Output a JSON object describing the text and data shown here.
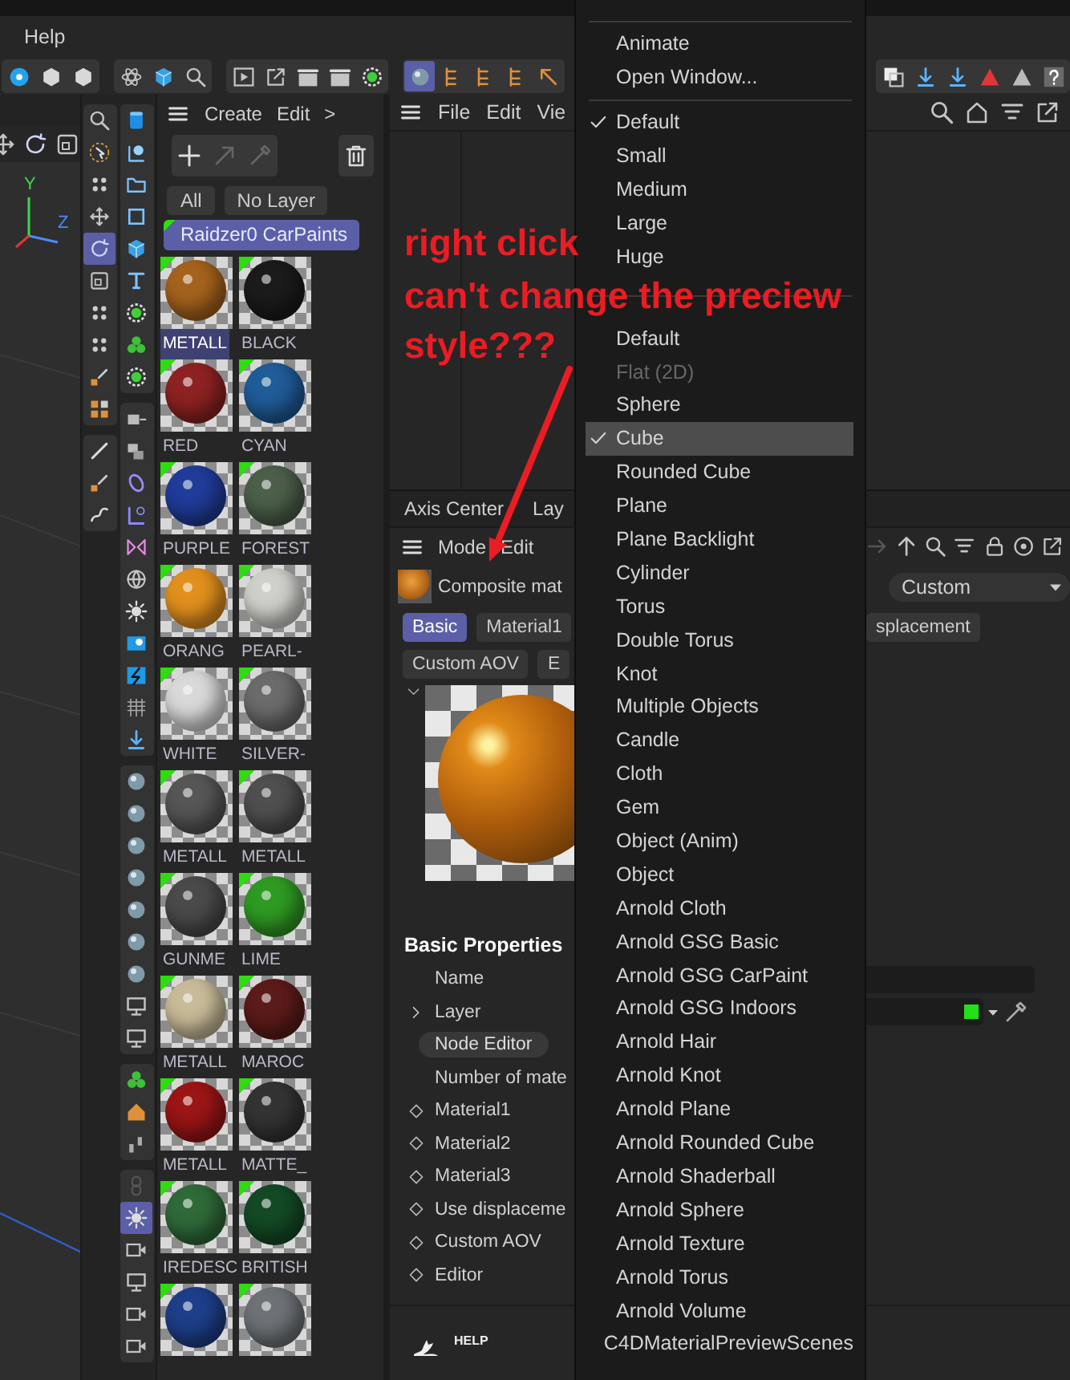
{
  "menu_bar": {
    "items": [
      "Help"
    ]
  },
  "toolbar": {
    "groups": [
      {
        "tools": [
          {
            "kind": "badge",
            "selected": false
          },
          {
            "kind": "hex",
            "selected": false
          },
          {
            "kind": "hex",
            "selected": false
          }
        ]
      },
      {
        "tools": [
          {
            "kind": "atom",
            "selected": false
          },
          {
            "kind": "cube",
            "selected": false
          },
          {
            "kind": "search",
            "selected": false
          }
        ]
      },
      {
        "tools": [
          {
            "kind": "play",
            "selected": false
          },
          {
            "kind": "external",
            "selected": false
          },
          {
            "kind": "film",
            "selected": false
          },
          {
            "kind": "film",
            "selected": false
          },
          {
            "kind": "gear",
            "selected": false
          }
        ]
      },
      {
        "tools": [
          {
            "kind": "sphere",
            "selected": true
          },
          {
            "kind": "tree",
            "selected": false
          },
          {
            "kind": "tree",
            "selected": false
          },
          {
            "kind": "tree",
            "selected": false
          },
          {
            "kind": "arrow",
            "selected": false
          }
        ]
      },
      {
        "tools": [
          {
            "kind": "stack",
            "selected": false
          },
          {
            "kind": "download",
            "selected": false
          },
          {
            "kind": "download",
            "selected": false
          },
          {
            "kind": "triangle",
            "selected": false
          },
          {
            "kind": "warn",
            "selected": false
          },
          {
            "kind": "help",
            "selected": false
          }
        ]
      }
    ]
  },
  "viewport": {
    "gizmo": {
      "y_label": "Y",
      "z_label": "Z"
    }
  },
  "tool_column_1": {
    "groups": [
      {
        "tools": [
          {
            "kind": "search",
            "selected": false
          },
          {
            "kind": "cursor",
            "selected": false
          },
          {
            "kind": "dots",
            "selected": false
          },
          {
            "kind": "move",
            "selected": false
          },
          {
            "kind": "rotate",
            "selected": true
          },
          {
            "kind": "scale",
            "selected": false
          },
          {
            "kind": "dots",
            "selected": false
          },
          {
            "kind": "dots",
            "selected": false
          },
          {
            "kind": "pen",
            "selected": false
          },
          {
            "kind": "cubes",
            "selected": false
          }
        ]
      },
      {
        "tools": [
          {
            "kind": "brush",
            "selected": false
          },
          {
            "kind": "pen",
            "selected": false
          },
          {
            "kind": "spline",
            "selected": false
          }
        ]
      }
    ]
  },
  "tool_column_2": {
    "groups": [
      {
        "tools": [
          {
            "kind": "cylinder",
            "selected": false
          },
          {
            "kind": "frame",
            "selected": false
          },
          {
            "kind": "folder",
            "selected": false
          },
          {
            "kind": "square",
            "selected": false
          },
          {
            "kind": "cube",
            "selected": false
          },
          {
            "kind": "text",
            "selected": false
          },
          {
            "kind": "gear",
            "selected": false
          },
          {
            "kind": "clover",
            "selected": false
          },
          {
            "kind": "gear",
            "selected": false
          }
        ]
      },
      {
        "tools": [
          {
            "kind": "crate",
            "selected": false
          },
          {
            "kind": "crates",
            "selected": false
          },
          {
            "kind": "ring",
            "selected": false
          },
          {
            "kind": "bracket",
            "selected": false
          },
          {
            "kind": "bow",
            "selected": false
          },
          {
            "kind": "globe",
            "selected": false
          },
          {
            "kind": "sun",
            "selected": false
          },
          {
            "kind": "box",
            "selected": false
          },
          {
            "kind": "bolt",
            "selected": false
          },
          {
            "kind": "grid",
            "selected": false
          },
          {
            "kind": "download",
            "selected": false
          }
        ]
      },
      {
        "tools": [
          {
            "kind": "sphere",
            "selected": false
          },
          {
            "kind": "sphere",
            "selected": false
          },
          {
            "kind": "sphere",
            "selected": false
          },
          {
            "kind": "sphere",
            "selected": false
          },
          {
            "kind": "sphere",
            "selected": false
          },
          {
            "kind": "sphere",
            "selected": false
          },
          {
            "kind": "sphere",
            "selected": false
          },
          {
            "kind": "monitor",
            "selected": false
          },
          {
            "kind": "monitor",
            "selected": false
          }
        ]
      },
      {
        "tools": [
          {
            "kind": "clover",
            "selected": false
          },
          {
            "kind": "house",
            "selected": false
          },
          {
            "kind": "bars",
            "selected": false
          }
        ]
      },
      {
        "tools": [
          {
            "kind": "link",
            "selected": false
          },
          {
            "kind": "sun",
            "selected": true
          },
          {
            "kind": "camera",
            "selected": false
          },
          {
            "kind": "monitor",
            "selected": false
          },
          {
            "kind": "camera",
            "selected": false
          },
          {
            "kind": "camera",
            "selected": false
          }
        ]
      }
    ]
  },
  "material_manager": {
    "menu": [
      "Create",
      "Edit",
      ">"
    ],
    "actions": [
      {
        "kind": "add",
        "disabled": false
      },
      {
        "kind": "arrow",
        "disabled": true
      },
      {
        "kind": "eyedropper",
        "disabled": true
      },
      {
        "kind": "delete",
        "disabled": false
      }
    ],
    "filters": [
      {
        "label": "All",
        "selected": false
      },
      {
        "label": "No Layer",
        "selected": false
      }
    ],
    "layer": "Raidzer0 CarPaints",
    "materials": [
      {
        "name": "METALL",
        "color": "#a5621c",
        "selected": true
      },
      {
        "name": "BLACK",
        "color": "#1b1b1b",
        "selected": false
      },
      {
        "name": "RED",
        "color": "#8e2222",
        "selected": false
      },
      {
        "name": "CYAN",
        "color": "#1f5c98",
        "selected": false
      },
      {
        "name": "PURPLE",
        "color": "#203c9a",
        "selected": false
      },
      {
        "name": "FOREST",
        "color": "#4b5f49",
        "selected": false
      },
      {
        "name": "ORANG",
        "color": "#e2901d",
        "selected": false
      },
      {
        "name": "PEARL-",
        "color": "#cfcfcb",
        "selected": false
      },
      {
        "name": "WHITE",
        "color": "#d9d9d9",
        "selected": false
      },
      {
        "name": "SILVER-",
        "color": "#6b6b6b",
        "selected": false
      },
      {
        "name": "METALL",
        "color": "#565656",
        "selected": false
      },
      {
        "name": "METALL",
        "color": "#4f4f4f",
        "selected": false
      },
      {
        "name": "GUNME",
        "color": "#4a4a4a",
        "selected": false
      },
      {
        "name": "LIME",
        "color": "#2f9a23",
        "selected": false
      },
      {
        "name": "METALL",
        "color": "#c8bb98",
        "selected": false
      },
      {
        "name": "MAROC",
        "color": "#5b1b19",
        "selected": false
      },
      {
        "name": "METALL",
        "color": "#9b1515",
        "selected": false
      },
      {
        "name": "MATTE_",
        "color": "#333333",
        "selected": false
      },
      {
        "name": "IREDESC",
        "color": "#2f6a39",
        "selected": false
      },
      {
        "name": "BRITISH",
        "color": "#134a25",
        "selected": false
      },
      {
        "color": "#1d3f8a",
        "selected": false
      },
      {
        "color": "#6e7277",
        "selected": false
      }
    ]
  },
  "node_editor": {
    "menu": [
      "File",
      "Edit",
      "Vie"
    ]
  },
  "attribute_manager": {
    "top_tabs": [
      {
        "label": "Axis Center",
        "selected": false
      },
      {
        "label": "Lay",
        "selected": false
      }
    ],
    "menu": [
      "Mode",
      "Edit"
    ],
    "object_name": "Composite mat",
    "preset": "Custom",
    "tabs": [
      {
        "label": "Basic",
        "selected": true
      },
      {
        "label": "Material1",
        "selected": false
      },
      {
        "label": "splacement",
        "selected": false
      }
    ],
    "tabs_row_2": [
      {
        "label": "Custom AOV",
        "selected": false
      },
      {
        "label": "E",
        "selected": false
      }
    ],
    "section": "Basic Properties",
    "properties": [
      {
        "kind": "field",
        "label": "Name",
        "expandable": false
      },
      {
        "kind": "color",
        "label": "Layer",
        "expandable": true,
        "color": "#22e01a"
      },
      {
        "kind": "button",
        "label": "Node Editor",
        "expandable": false
      },
      {
        "kind": "plain",
        "label": "Number of mate",
        "expandable": false
      },
      {
        "kind": "keyframe",
        "label": "Material1",
        "expandable": false
      },
      {
        "kind": "keyframe",
        "label": "Material2",
        "expandable": false
      },
      {
        "kind": "keyframe",
        "label": "Material3",
        "expandable": false
      },
      {
        "kind": "keyframe",
        "label": "Use displaceme",
        "expandable": false
      },
      {
        "kind": "keyframe",
        "label": "Custom AOV",
        "expandable": false
      },
      {
        "kind": "keyframe",
        "label": "Editor",
        "expandable": false
      }
    ],
    "help": "HELP"
  },
  "context_menu": {
    "sections": [
      {
        "items": [
          {
            "label": "Animate",
            "checked": false,
            "selected": false,
            "disabled": false
          },
          {
            "label": "Open Window...",
            "checked": false,
            "selected": false,
            "disabled": false
          }
        ]
      },
      {
        "items": [
          {
            "label": "Default",
            "checked": true,
            "selected": false,
            "disabled": false
          },
          {
            "label": "Small",
            "checked": false,
            "selected": false,
            "disabled": false
          },
          {
            "label": "Medium",
            "checked": false,
            "selected": false,
            "disabled": false
          },
          {
            "label": "Large",
            "checked": false,
            "selected": false,
            "disabled": false
          },
          {
            "label": "Huge",
            "checked": false,
            "selected": false,
            "disabled": false
          }
        ]
      },
      {
        "items": [
          {
            "label": "Default",
            "checked": false,
            "selected": false,
            "disabled": false
          },
          {
            "label": "Flat (2D)",
            "checked": false,
            "selected": false,
            "disabled": true
          },
          {
            "label": "Sphere",
            "checked": false,
            "selected": false,
            "disabled": false
          },
          {
            "label": "Cube",
            "checked": true,
            "selected": true,
            "disabled": false
          },
          {
            "label": "Rounded Cube",
            "checked": false,
            "selected": false,
            "disabled": false
          },
          {
            "label": "Plane",
            "checked": false,
            "selected": false,
            "disabled": false
          },
          {
            "label": "Plane Backlight",
            "checked": false,
            "selected": false,
            "disabled": false
          },
          {
            "label": "Cylinder",
            "checked": false,
            "selected": false,
            "disabled": false
          },
          {
            "label": "Torus",
            "checked": false,
            "selected": false,
            "disabled": false
          },
          {
            "label": "Double Torus",
            "checked": false,
            "selected": false,
            "disabled": false
          },
          {
            "label": "Knot",
            "checked": false,
            "selected": false,
            "disabled": false
          },
          {
            "label": "Multiple Objects",
            "checked": false,
            "selected": false,
            "disabled": false
          },
          {
            "label": "Candle",
            "checked": false,
            "selected": false,
            "disabled": false
          },
          {
            "label": "Cloth",
            "checked": false,
            "selected": false,
            "disabled": false
          },
          {
            "label": "Gem",
            "checked": false,
            "selected": false,
            "disabled": false
          },
          {
            "label": "Object (Anim)",
            "checked": false,
            "selected": false,
            "disabled": false
          },
          {
            "label": "Object",
            "checked": false,
            "selected": false,
            "disabled": false
          },
          {
            "label": "Arnold Cloth",
            "checked": false,
            "selected": false,
            "disabled": false
          },
          {
            "label": "Arnold GSG Basic",
            "checked": false,
            "selected": false,
            "disabled": false
          },
          {
            "label": "Arnold GSG CarPaint",
            "checked": false,
            "selected": false,
            "disabled": false
          },
          {
            "label": "Arnold GSG Indoors",
            "checked": false,
            "selected": false,
            "disabled": false
          },
          {
            "label": "Arnold Hair",
            "checked": false,
            "selected": false,
            "disabled": false
          },
          {
            "label": "Arnold Knot",
            "checked": false,
            "selected": false,
            "disabled": false
          },
          {
            "label": "Arnold Plane",
            "checked": false,
            "selected": false,
            "disabled": false
          },
          {
            "label": "Arnold Rounded Cube",
            "checked": false,
            "selected": false,
            "disabled": false
          },
          {
            "label": "Arnold Shaderball",
            "checked": false,
            "selected": false,
            "disabled": false
          },
          {
            "label": "Arnold Sphere",
            "checked": false,
            "selected": false,
            "disabled": false
          },
          {
            "label": "Arnold Texture",
            "checked": false,
            "selected": false,
            "disabled": false
          },
          {
            "label": "Arnold Torus",
            "checked": false,
            "selected": false,
            "disabled": false
          },
          {
            "label": "Arnold Volume",
            "checked": false,
            "selected": false,
            "disabled": false
          },
          {
            "label": "C4DMaterialPreviewScenes",
            "checked": false,
            "selected": false,
            "disabled": false
          }
        ]
      }
    ]
  },
  "annotation": {
    "lines": [
      "right click",
      "can't change the preciew",
      "style???"
    ]
  }
}
